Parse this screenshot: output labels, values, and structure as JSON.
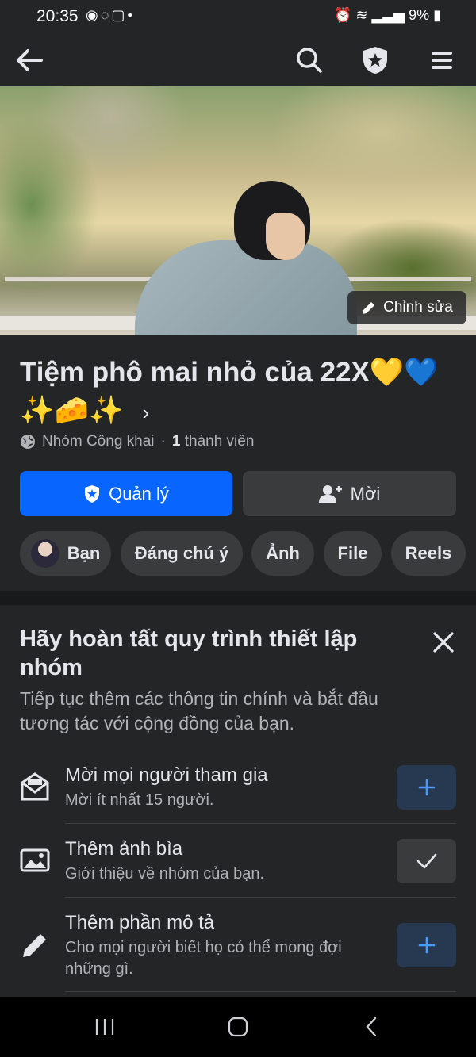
{
  "status_bar": {
    "time": "20:35",
    "app_icons": [
      "weibo-icon",
      "messenger-icon",
      "instagram-icon"
    ],
    "battery": "9%"
  },
  "nav": {
    "icons": [
      "back-arrow-icon",
      "search-icon",
      "admin-shield-icon",
      "menu-icon"
    ]
  },
  "cover": {
    "edit_label": "Chỉnh sửa"
  },
  "group": {
    "name": "Tiệm phô mai nhỏ của 22X💛💙✨🧀✨",
    "privacy": "Nhóm Công khai",
    "separator": "·",
    "member_count": "1",
    "member_label": "thành viên"
  },
  "actions": {
    "manage_label": "Quản lý",
    "invite_label": "Mời"
  },
  "tabs": [
    {
      "label": "Bạn"
    },
    {
      "label": "Đáng chú ý"
    },
    {
      "label": "Ảnh"
    },
    {
      "label": "File"
    },
    {
      "label": "Reels"
    }
  ],
  "setup": {
    "title": "Hãy hoàn tất quy trình thiết lập nhóm",
    "subtitle": "Tiếp tục thêm các thông tin chính và bắt đầu tương tác với cộng đồng của bạn.",
    "tasks": [
      {
        "title": "Mời mọi người tham gia",
        "description": "Mời ít nhất 15 người.",
        "status": "add",
        "icon": "invite-envelope-icon"
      },
      {
        "title": "Thêm ảnh bìa",
        "description": "Giới thiệu về nhóm của bạn.",
        "status": "done",
        "icon": "photo-icon"
      },
      {
        "title": "Thêm phần mô tả",
        "description": "Cho mọi người biết họ có thể mong đợi những gì.",
        "status": "add",
        "icon": "pencil-icon"
      }
    ]
  },
  "colors": {
    "background": "#242526",
    "primary": "#0866ff",
    "secondary_button": "#3a3b3c",
    "add_button": "#263951"
  }
}
